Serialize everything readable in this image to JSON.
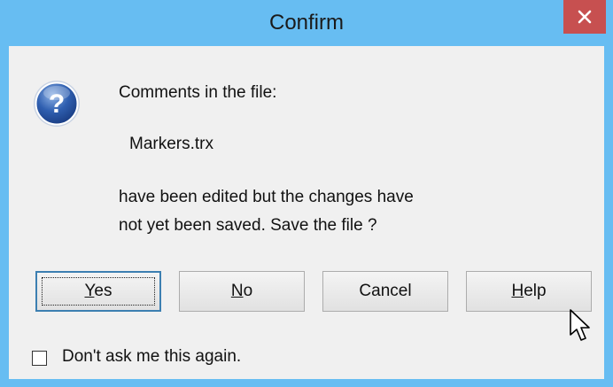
{
  "window": {
    "title": "Confirm",
    "close_icon": "close-icon"
  },
  "dialog": {
    "icon": "question-icon",
    "line1": "Comments in the file:",
    "filename": "Markers.trx",
    "line3": "have been edited but the changes have",
    "line4": "not yet been saved.  Save the file ?"
  },
  "buttons": {
    "yes": {
      "prefix": "",
      "mnemonic": "Y",
      "rest": "es"
    },
    "no": {
      "prefix": "",
      "mnemonic": "N",
      "rest": "o"
    },
    "cancel": {
      "label": "Cancel"
    },
    "help": {
      "prefix": "",
      "mnemonic": "H",
      "rest": "elp"
    }
  },
  "checkbox": {
    "label": "Don't ask me this again.",
    "checked": false
  },
  "colors": {
    "titlebar": "#67bdf2",
    "close_button": "#c75050",
    "client": "#f0f0f0",
    "default_button_border": "#3c7fb1"
  },
  "cursor_icon": "mouse-pointer-icon"
}
